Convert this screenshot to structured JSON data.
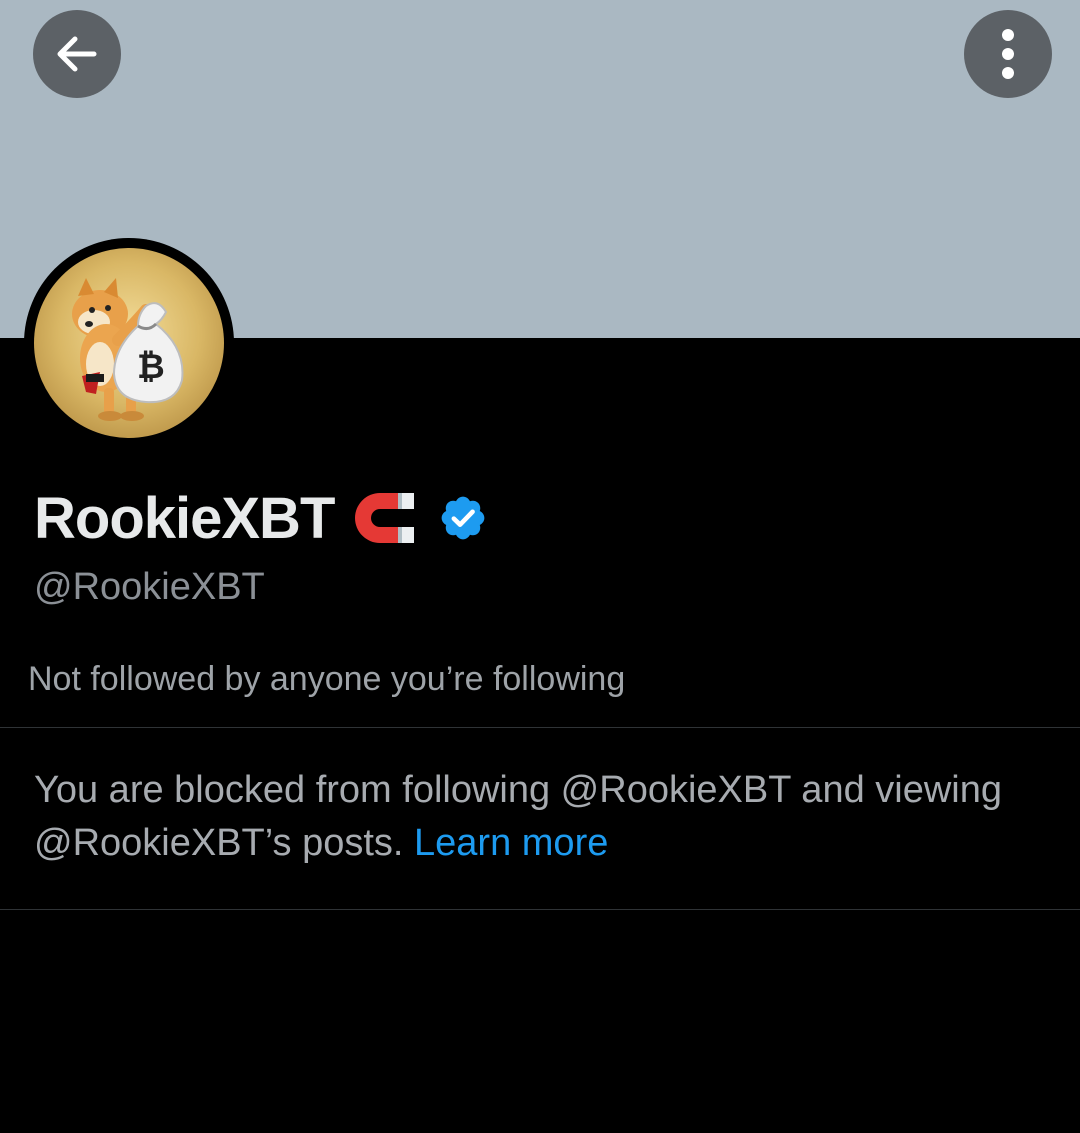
{
  "header": {
    "banner_color": "#aab8c2",
    "back_icon": "arrow-left-icon",
    "more_icon": "more-vertical-icon"
  },
  "profile": {
    "avatar_icon": "doge-bitcoin-bag-avatar",
    "display_name": "RookieXBT",
    "name_emoji": "magnet-emoji",
    "verified_icon": "verified-badge-icon",
    "verified_color": "#1d9bf0",
    "handle": "@RookieXBT",
    "followed_by": "Not followed by anyone you’re following"
  },
  "blocked": {
    "message": "You are blocked from following @RookieXBT and viewing @RookieXBT’s posts.",
    "link_label": "Learn more",
    "link_color": "#1d9bf0"
  }
}
